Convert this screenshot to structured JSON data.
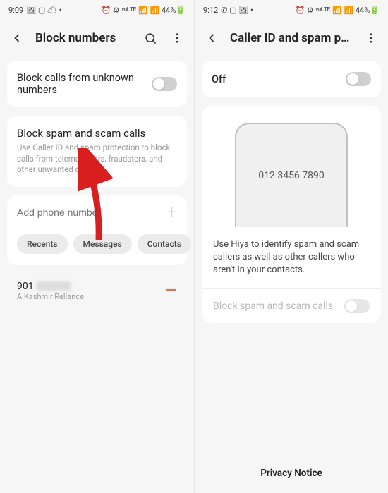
{
  "left": {
    "status": {
      "time": "9:09",
      "icons_left": "🖼 ▢ ☁ •",
      "icons_right": "⏰ ⚙ ᵛᵒᴸᵀᴱ 📶 📶 44%🔋"
    },
    "header": {
      "title": "Block numbers"
    },
    "card1": {
      "label": "Block calls from unknown numbers"
    },
    "card2": {
      "title": "Block spam and scam calls",
      "sub": "Use Caller ID and spam protection to block calls from telemarketers, fraudsters, and other unwanted callers."
    },
    "input": {
      "placeholder": "Add phone number"
    },
    "chips": {
      "recents": "Recents",
      "messages": "Messages",
      "contacts": "Contacts"
    },
    "list": {
      "num": "901",
      "carrier": "A Kashmir Reliance"
    }
  },
  "right": {
    "status": {
      "time": "9:12",
      "icons_left": "✆ ▢ 🖼 •",
      "icons_right": "⏰ ⚙ ᵛᵒᴸᵀᴱ 📶 📶 44%🔋"
    },
    "header": {
      "title": "Caller ID and spam p…"
    },
    "card1": {
      "label": "Off"
    },
    "illustration": {
      "number": "012 3456 7890"
    },
    "info": "Use Hiya to identify spam and scam callers as well as other callers who aren't in your contacts.",
    "bottom": {
      "label": "Block spam and scam calls"
    },
    "privacy": "Privacy Notice"
  }
}
